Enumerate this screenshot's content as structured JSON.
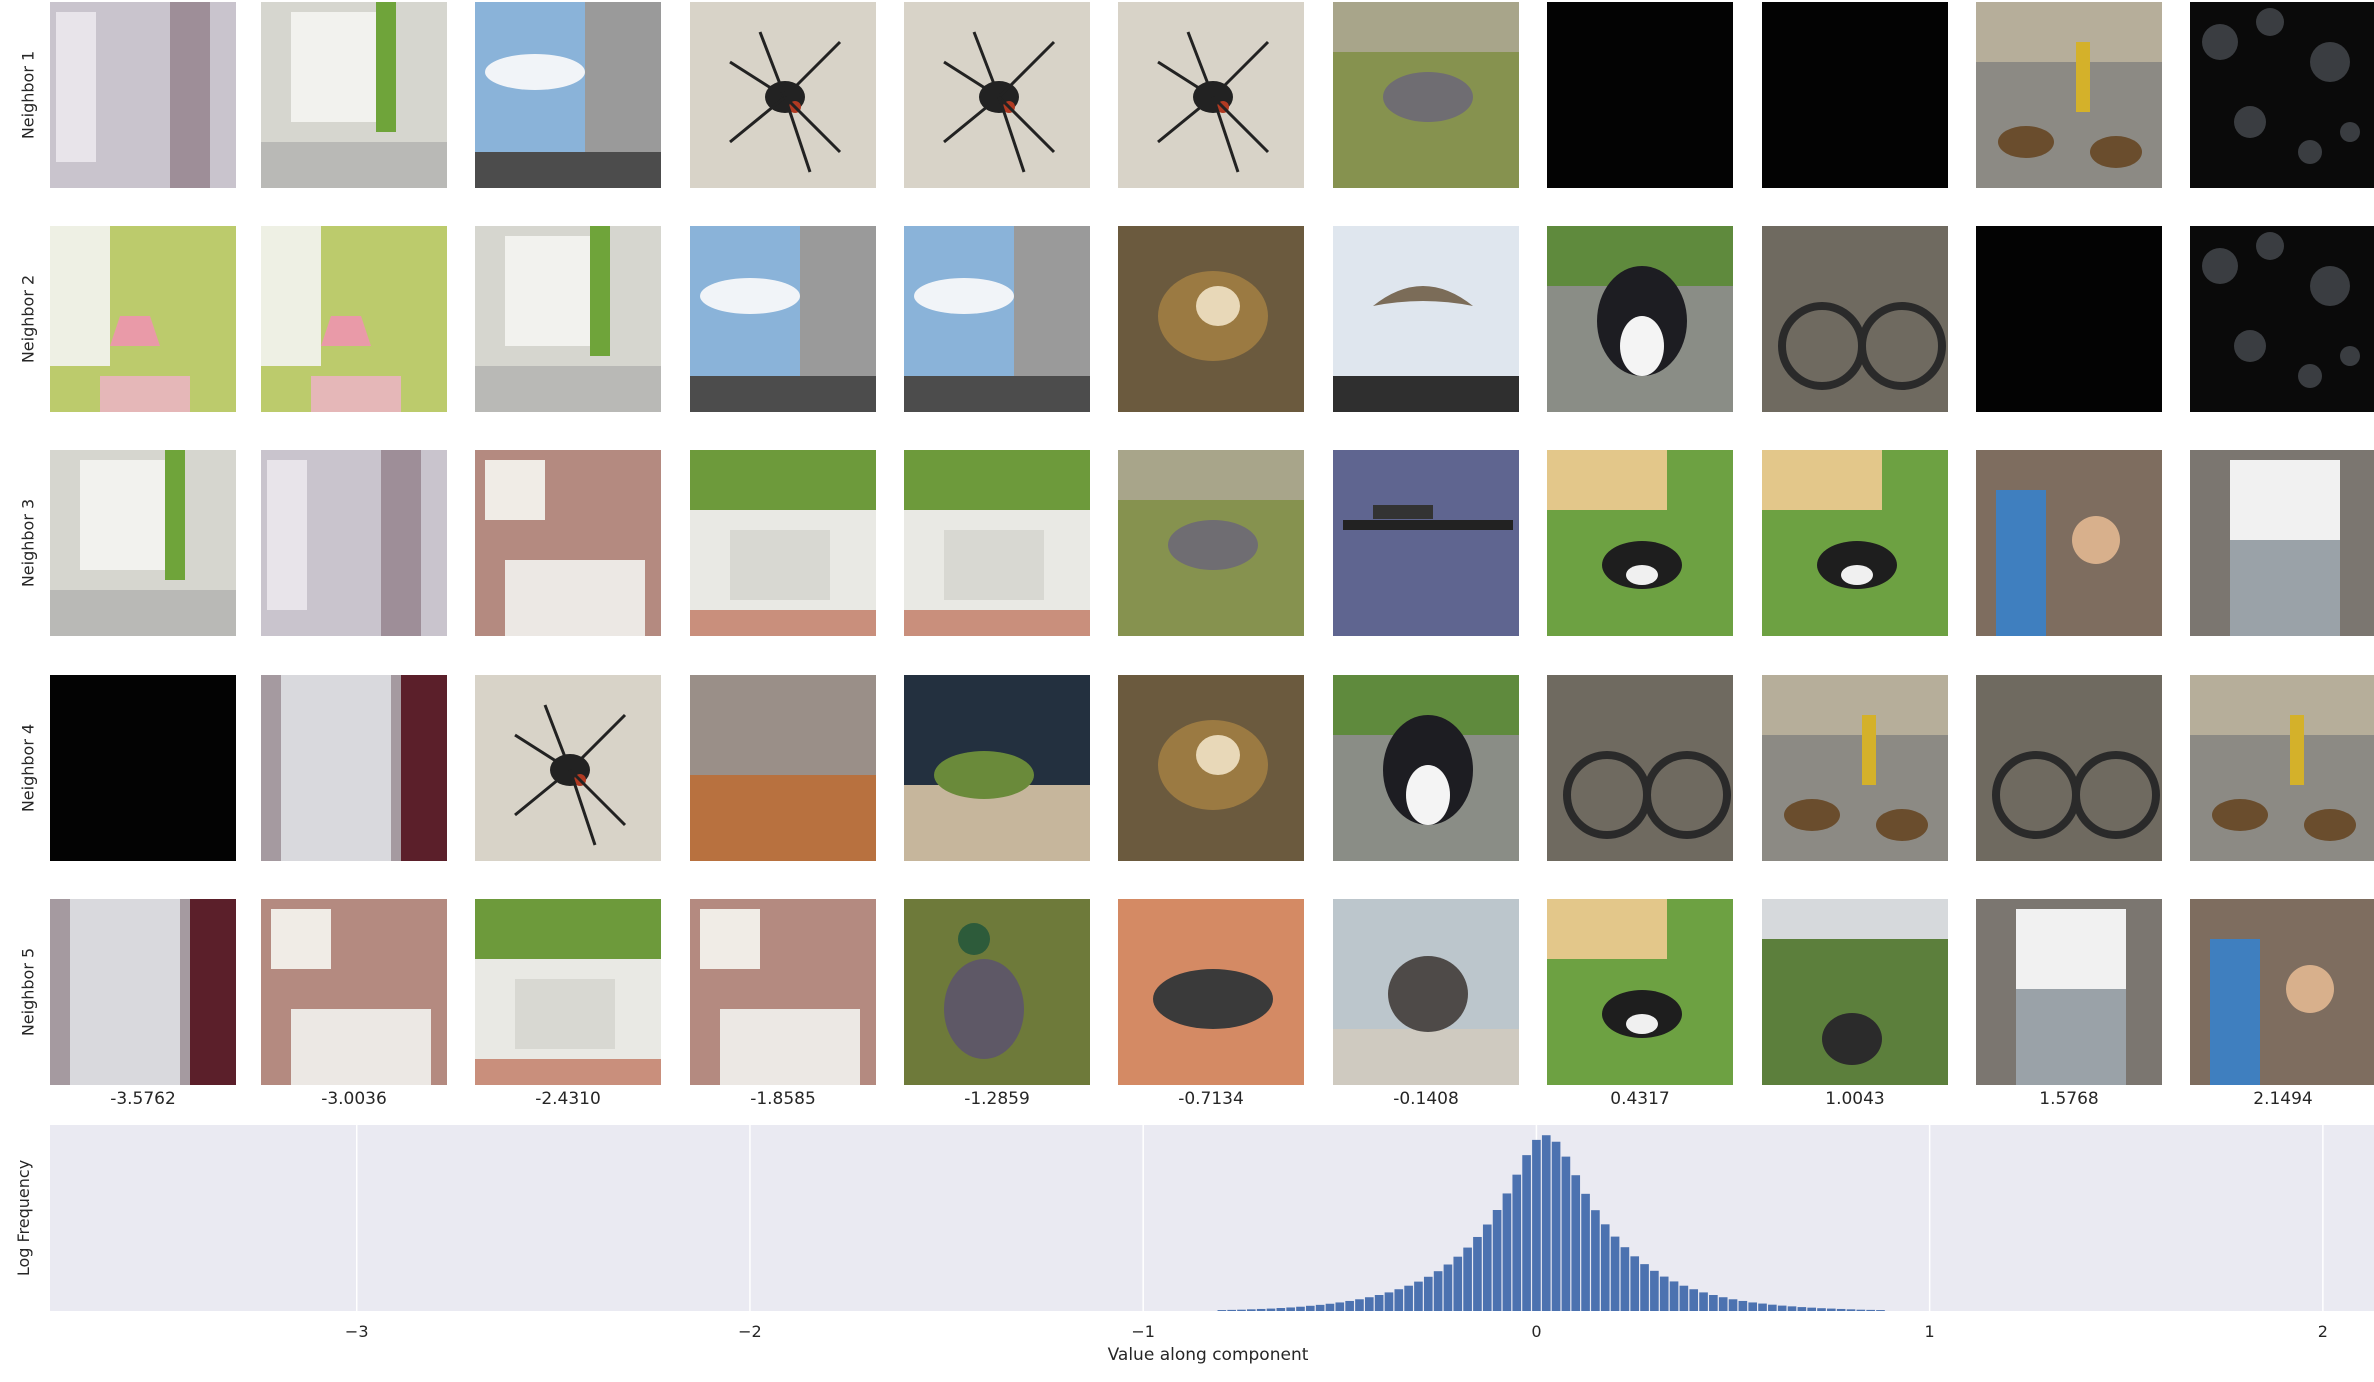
{
  "row_labels": [
    "Neighbor 1",
    "Neighbor 2",
    "Neighbor 3",
    "Neighbor 4",
    "Neighbor 5"
  ],
  "column_values": [
    "-3.5762",
    "-3.0036",
    "-2.4310",
    "-1.8585",
    "-1.2859",
    "-0.7134",
    "-0.1408",
    "0.4317",
    "1.0043",
    "1.5768",
    "2.1494"
  ],
  "tiles": [
    [
      "window-curtain",
      "window-green-curtain",
      "tv-window",
      "spider",
      "spider",
      "spider",
      "dog-field",
      "dark",
      "dark",
      "dogs-crowd",
      "dark-masked"
    ],
    [
      "green-room-lamp",
      "green-room-lamp",
      "window-green-curtain",
      "tv-window",
      "tv-window",
      "monkey",
      "pelicans",
      "puppy",
      "bike-crowd",
      "dark",
      "dark-masked"
    ],
    [
      "window-green-curtain",
      "window-curtain",
      "bathroom-sink",
      "kitchen",
      "kitchen",
      "dog-field",
      "rifle",
      "dog-lawn",
      "dog-lawn",
      "people",
      "trash-can"
    ],
    [
      "dark",
      "fridge",
      "spider",
      "kitchen-shelves",
      "frog",
      "monkey",
      "puppy",
      "bike-crowd",
      "dogs-crowd",
      "bike-crowd",
      "dogs-crowd"
    ],
    [
      "fridge",
      "bathroom-sink",
      "kitchen",
      "bathroom-sink",
      "duck",
      "beetle",
      "elephant",
      "dog-lawn",
      "gardener",
      "trash-can",
      "people"
    ]
  ],
  "palette": {
    "axes_bg": "#eaeaf2",
    "grid": "#ffffff",
    "bar": "#4c72b0",
    "text": "#262626"
  },
  "chart_data": {
    "type": "bar",
    "xlabel": "Value along component",
    "ylabel": "Log Frequency",
    "xlim": [
      -3.78,
      2.13
    ],
    "ylim": [
      0,
      10
    ],
    "xticks": [
      -3,
      -2,
      -1,
      0,
      1,
      2
    ],
    "xtick_labels": [
      "−3",
      "−2",
      "−1",
      "0",
      "1",
      "2"
    ],
    "grid": true,
    "bin_width": 0.025,
    "bins": [
      {
        "x": -0.8,
        "y": 0.05
      },
      {
        "x": -0.775,
        "y": 0.06
      },
      {
        "x": -0.75,
        "y": 0.07
      },
      {
        "x": -0.725,
        "y": 0.09
      },
      {
        "x": -0.7,
        "y": 0.11
      },
      {
        "x": -0.675,
        "y": 0.13
      },
      {
        "x": -0.65,
        "y": 0.16
      },
      {
        "x": -0.625,
        "y": 0.19
      },
      {
        "x": -0.6,
        "y": 0.23
      },
      {
        "x": -0.575,
        "y": 0.28
      },
      {
        "x": -0.55,
        "y": 0.33
      },
      {
        "x": -0.525,
        "y": 0.39
      },
      {
        "x": -0.5,
        "y": 0.46
      },
      {
        "x": -0.475,
        "y": 0.54
      },
      {
        "x": -0.45,
        "y": 0.63
      },
      {
        "x": -0.425,
        "y": 0.74
      },
      {
        "x": -0.4,
        "y": 0.86
      },
      {
        "x": -0.375,
        "y": 1.0
      },
      {
        "x": -0.35,
        "y": 1.17
      },
      {
        "x": -0.325,
        "y": 1.36
      },
      {
        "x": -0.3,
        "y": 1.58
      },
      {
        "x": -0.275,
        "y": 1.84
      },
      {
        "x": -0.25,
        "y": 2.14
      },
      {
        "x": -0.225,
        "y": 2.5
      },
      {
        "x": -0.2,
        "y": 2.92
      },
      {
        "x": -0.175,
        "y": 3.41
      },
      {
        "x": -0.15,
        "y": 3.98
      },
      {
        "x": -0.125,
        "y": 4.65
      },
      {
        "x": -0.1,
        "y": 5.43
      },
      {
        "x": -0.075,
        "y": 6.32
      },
      {
        "x": -0.05,
        "y": 7.33
      },
      {
        "x": -0.025,
        "y": 8.38
      },
      {
        "x": 0.0,
        "y": 9.2
      },
      {
        "x": 0.025,
        "y": 9.45
      },
      {
        "x": 0.05,
        "y": 9.1
      },
      {
        "x": 0.075,
        "y": 8.3
      },
      {
        "x": 0.1,
        "y": 7.3
      },
      {
        "x": 0.125,
        "y": 6.3
      },
      {
        "x": 0.15,
        "y": 5.42
      },
      {
        "x": 0.175,
        "y": 4.66
      },
      {
        "x": 0.2,
        "y": 4.0
      },
      {
        "x": 0.225,
        "y": 3.43
      },
      {
        "x": 0.25,
        "y": 2.94
      },
      {
        "x": 0.275,
        "y": 2.52
      },
      {
        "x": 0.3,
        "y": 2.16
      },
      {
        "x": 0.325,
        "y": 1.85
      },
      {
        "x": 0.35,
        "y": 1.59
      },
      {
        "x": 0.375,
        "y": 1.36
      },
      {
        "x": 0.4,
        "y": 1.17
      },
      {
        "x": 0.425,
        "y": 1.0
      },
      {
        "x": 0.45,
        "y": 0.86
      },
      {
        "x": 0.475,
        "y": 0.74
      },
      {
        "x": 0.5,
        "y": 0.63
      },
      {
        "x": 0.525,
        "y": 0.54
      },
      {
        "x": 0.55,
        "y": 0.46
      },
      {
        "x": 0.575,
        "y": 0.4
      },
      {
        "x": 0.6,
        "y": 0.34
      },
      {
        "x": 0.625,
        "y": 0.29
      },
      {
        "x": 0.65,
        "y": 0.25
      },
      {
        "x": 0.675,
        "y": 0.21
      },
      {
        "x": 0.7,
        "y": 0.18
      },
      {
        "x": 0.725,
        "y": 0.15
      },
      {
        "x": 0.75,
        "y": 0.13
      },
      {
        "x": 0.775,
        "y": 0.11
      },
      {
        "x": 0.8,
        "y": 0.09
      },
      {
        "x": 0.825,
        "y": 0.07
      },
      {
        "x": 0.85,
        "y": 0.06
      },
      {
        "x": 0.875,
        "y": 0.05
      }
    ]
  }
}
